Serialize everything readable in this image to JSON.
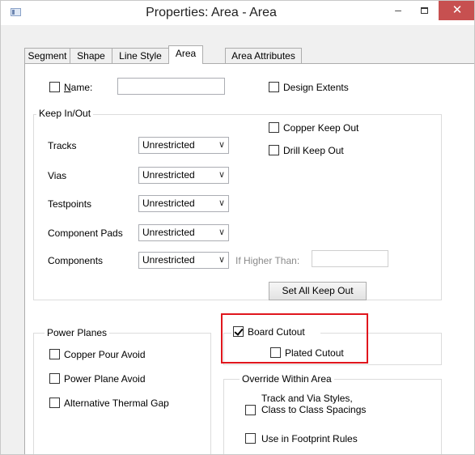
{
  "window": {
    "title": "Properties: Area - Area",
    "minimize_glyph": "–",
    "close_glyph": "✕"
  },
  "tabs": [
    {
      "label": "Segment"
    },
    {
      "label": "Shape"
    },
    {
      "label": "Line Style"
    },
    {
      "label": "Area",
      "active": true
    },
    {
      "label": "Area Attributes"
    }
  ],
  "area": {
    "name_label": "Name:",
    "name_value": "",
    "design_extents_label": "Design Extents"
  },
  "keep_in_out": {
    "title": "Keep In/Out",
    "copper_keep_out": "Copper  Keep Out",
    "drill_keep_out": "Drill  Keep Out",
    "rows": [
      {
        "label": "Tracks",
        "value": "Unrestricted"
      },
      {
        "label": "Vias",
        "value": "Unrestricted"
      },
      {
        "label": "Testpoints",
        "value": "Unrestricted"
      },
      {
        "label": "Component Pads",
        "value": "Unrestricted"
      },
      {
        "label": "Components",
        "value": "Unrestricted"
      }
    ],
    "if_higher_than_label": "If Higher Than:",
    "if_higher_than_value": "",
    "set_all_button": "Set All Keep Out"
  },
  "power_planes": {
    "title": "Power Planes",
    "copper_pour_avoid": "Copper Pour Avoid",
    "power_plane_avoid": "Power Plane Avoid",
    "alternative_thermal_gap": "Alternative Thermal Gap"
  },
  "board_cutout": {
    "label": "Board Cutout",
    "checked": true,
    "plated_cutout": "Plated Cutout"
  },
  "override": {
    "title": "Override Within Area",
    "track_via_line1": "Track and Via Styles,",
    "track_via_line2": "Class to Class Spacings",
    "use_in_footprint": "Use in Footprint Rules"
  },
  "colors": {
    "close_button": "#c75050",
    "highlight": "#e0161d"
  }
}
